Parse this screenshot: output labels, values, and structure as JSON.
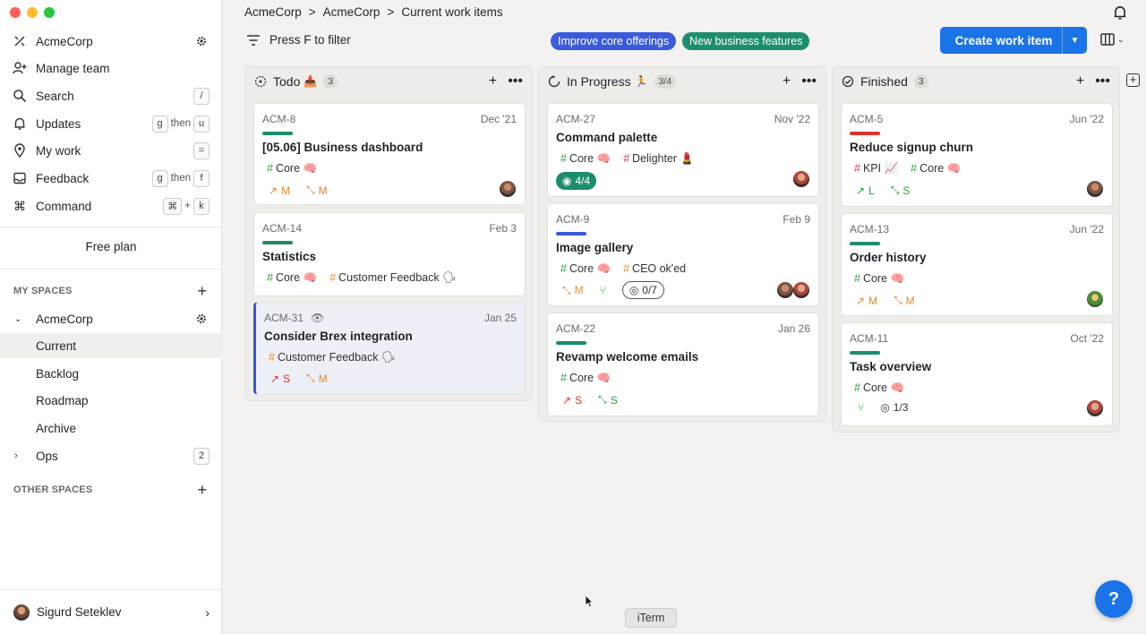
{
  "sidebar": {
    "workspace": "AcmeCorp",
    "nav": [
      {
        "label": "AcmeCorp",
        "icon": "logo-icon"
      },
      {
        "label": "Manage team",
        "icon": "add-user-icon"
      },
      {
        "label": "Search",
        "icon": "search-icon",
        "shortcut": [
          "/"
        ]
      },
      {
        "label": "Updates",
        "icon": "bell-icon",
        "shortcut": [
          "g",
          "then",
          "u"
        ]
      },
      {
        "label": "My work",
        "icon": "location-icon",
        "shortcut": [
          "="
        ]
      },
      {
        "label": "Feedback",
        "icon": "inbox-icon",
        "shortcut": [
          "g",
          "then",
          "f"
        ]
      },
      {
        "label": "Command",
        "icon": "command-icon",
        "shortcut": [
          "⌘",
          "+",
          "k"
        ]
      }
    ],
    "free_plan": "Free plan",
    "my_spaces_label": "MY SPACES",
    "space_name": "AcmeCorp",
    "space_items": [
      "Current",
      "Backlog",
      "Roadmap",
      "Archive"
    ],
    "ops_label": "Ops",
    "ops_count": "2",
    "other_spaces_label": "OTHER SPACES",
    "user_name": "Sigurd Seteklev"
  },
  "header": {
    "breadcrumb": [
      "AcmeCorp",
      ">",
      "AcmeCorp",
      ">",
      "Current work items"
    ],
    "filter_label": "Press F to filter",
    "pills": [
      {
        "label": "Improve core offerings",
        "color": "#3b5bdb"
      },
      {
        "label": "New business features",
        "color": "#1c8d6f"
      }
    ],
    "create_label": "Create work item"
  },
  "columns": [
    {
      "title": "Todo",
      "emoji": "📥",
      "count": "3",
      "cards": [
        {
          "id": "ACM-8",
          "date": "Dec '21",
          "bar_color": "#1c8d6f",
          "title": "[05.06] Business dashboard",
          "tags": [
            {
              "label": "Core 🧠",
              "hash": "green"
            }
          ],
          "meta": [
            {
              "label": "M",
              "color": "orange",
              "arrow": "↗"
            },
            {
              "label": "M",
              "color": "orange",
              "arrow": "⤡"
            }
          ]
        },
        {
          "id": "ACM-14",
          "date": "Feb 3",
          "bar_color": "#1c8d6f",
          "title": "Statistics",
          "tags": [
            {
              "label": "Core 🧠",
              "hash": "green"
            },
            {
              "label": "Customer Feedback 🗣",
              "hash": "orange"
            }
          ],
          "meta": []
        },
        {
          "id": "ACM-31",
          "date": "Jan 25",
          "bar_color": "",
          "title": "Consider Brex integration",
          "tags": [
            {
              "label": "Customer Feedback 🗣",
              "hash": "orange"
            }
          ],
          "meta": [
            {
              "label": "S",
              "color": "red",
              "arrow": "↗"
            },
            {
              "label": "M",
              "color": "orange",
              "arrow": "⤡"
            }
          ]
        }
      ]
    },
    {
      "title": "In Progress",
      "emoji": "🏃",
      "count": "3/4",
      "cards": [
        {
          "id": "ACM-27",
          "date": "Nov '22",
          "bar_color": "",
          "title": "Command palette",
          "tags": [
            {
              "label": "Core 🧠",
              "hash": "green"
            },
            {
              "label": "Delighter 💄",
              "hash": "red"
            }
          ],
          "checklist": "4/4"
        },
        {
          "id": "ACM-9",
          "date": "Feb 9",
          "bar_color": "#3b5bdb",
          "title": "Image gallery",
          "tags": [
            {
              "label": "Core 🧠",
              "hash": "green"
            },
            {
              "label": "CEO ok'ed",
              "hash": "orange"
            }
          ],
          "meta": [
            {
              "label": "M",
              "color": "orange",
              "arrow": "⤡"
            }
          ],
          "checklist": "0/7"
        },
        {
          "id": "ACM-22",
          "date": "Jan 26",
          "bar_color": "#1c8d6f",
          "title": "Revamp welcome emails",
          "tags": [
            {
              "label": "Core 🧠",
              "hash": "green"
            }
          ],
          "meta": [
            {
              "label": "S",
              "color": "red",
              "arrow": "↗"
            },
            {
              "label": "S",
              "color": "green",
              "arrow": "⤡"
            }
          ]
        }
      ]
    },
    {
      "title": "Finished",
      "emoji": "",
      "count": "3",
      "cards": [
        {
          "id": "ACM-5",
          "date": "Jun '22",
          "bar_color": "#e03131",
          "title": "Reduce signup churn",
          "tags": [
            {
              "label": "KPI 📈",
              "hash": "red"
            },
            {
              "label": "Core 🧠",
              "hash": "green"
            }
          ],
          "meta": [
            {
              "label": "L",
              "color": "green",
              "arrow": "↗"
            },
            {
              "label": "S",
              "color": "green",
              "arrow": "⤡"
            }
          ]
        },
        {
          "id": "ACM-13",
          "date": "Jun '22",
          "bar_color": "#1c8d6f",
          "title": "Order history",
          "tags": [
            {
              "label": "Core 🧠",
              "hash": "green"
            }
          ],
          "meta": [
            {
              "label": "M",
              "color": "orange",
              "arrow": "↗"
            },
            {
              "label": "M",
              "color": "orange",
              "arrow": "⤡"
            }
          ]
        },
        {
          "id": "ACM-11",
          "date": "Oct '22",
          "bar_color": "#1c8d6f",
          "title": "Task overview",
          "tags": [
            {
              "label": "Core 🧠",
              "hash": "green"
            }
          ],
          "checklist": "1/3"
        }
      ]
    }
  ],
  "dock_label": "iTerm",
  "help_label": "?"
}
